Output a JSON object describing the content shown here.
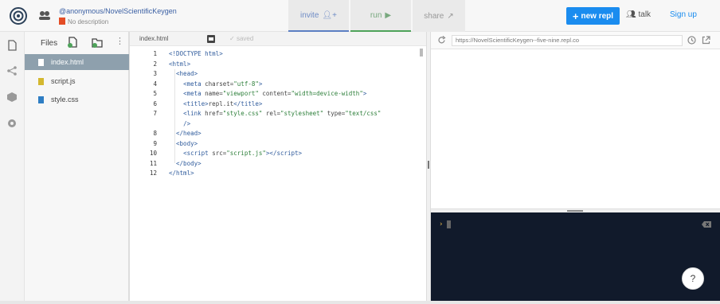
{
  "header": {
    "repl_path": "@anonymous/NovelScientificKeygen",
    "repl_desc": "No description",
    "invite_label": "invite",
    "run_label": "run",
    "share_label": "share",
    "new_repl_label": "new repl",
    "talk_label": "talk",
    "signup_label": "Sign up"
  },
  "files": {
    "title": "Files",
    "more": "⋮",
    "items": [
      {
        "name": "index.html",
        "active": true,
        "icon": "html-file-icon"
      },
      {
        "name": "script.js",
        "active": false,
        "icon": "js-file-icon"
      },
      {
        "name": "style.css",
        "active": false,
        "icon": "css-file-icon"
      }
    ]
  },
  "editor": {
    "tab": "index.html",
    "status": "saved",
    "line_numbers": [
      "1",
      "2",
      "3",
      "4",
      "5",
      "6",
      "7",
      "8",
      "9",
      "10",
      "11",
      "12"
    ]
  },
  "preview": {
    "url": "https://NovelScientificKeygen--five-nine.repl.co"
  },
  "console": {
    "prompt": "›"
  },
  "help": {
    "label": "?"
  },
  "colors": {
    "accent": "#1a8cef",
    "invite": "#5c7fc3",
    "run": "#4ea35a",
    "console_bg": "#111a2b"
  }
}
